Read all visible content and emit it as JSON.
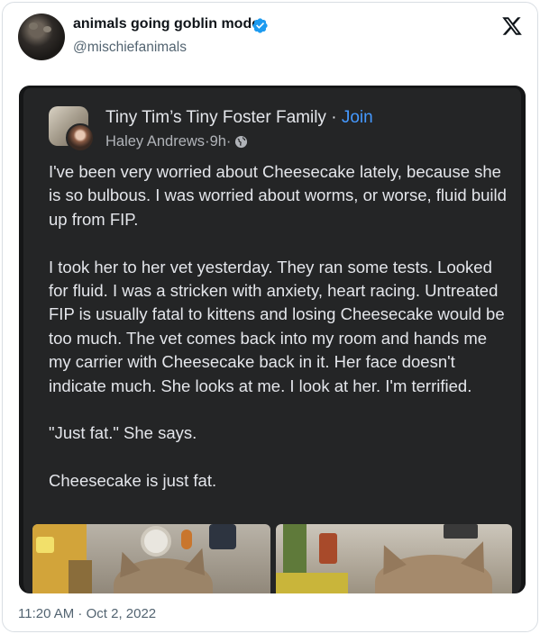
{
  "tweet": {
    "display_name": "animals going goblin mode",
    "handle": "@mischiefanimals",
    "timestamp": "11:20 AM · Oct 2, 2022",
    "icons": {
      "verified": "verified-badge-icon",
      "logo": "x-logo-icon"
    },
    "colors": {
      "verified": "#1d9bf0",
      "text": "#0f1419",
      "muted": "#536471"
    }
  },
  "embedded_post": {
    "group_name": "Tiny Tim’s Tiny Foster Family",
    "separator": " · ",
    "join_label": "Join",
    "author": "Haley Andrews",
    "age": "9h",
    "privacy_icon": "globe-icon",
    "colors": {
      "background": "#242526",
      "text": "#e4e6eb",
      "muted": "#b0b3b8",
      "link": "#4599ff"
    },
    "paragraphs": [
      "I've been very worried about Cheesecake lately, because she is so bulbous. I was worried about worms, or worse, fluid build up from FIP.",
      "I took her to her vet yesterday. They ran some tests. Looked for fluid. I was a stricken with anxiety, heart racing. Untreated FIP is usually fatal to kittens and losing Cheesecake would be too much. The vet comes back into my room and hands me my carrier with Cheesecake back in it. Her face doesn't indicate much. She looks at me. I look at her. I'm terrified.",
      "\"Just fat.\" She says.",
      "Cheesecake is just fat."
    ]
  }
}
